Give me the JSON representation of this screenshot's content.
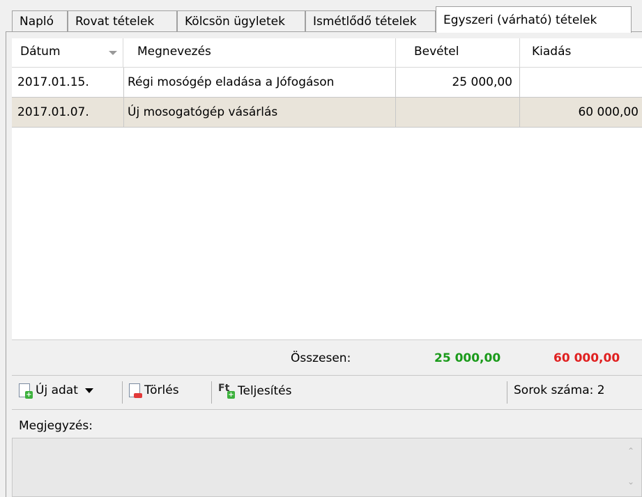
{
  "tabs": [
    {
      "label": "Napló"
    },
    {
      "label": "Rovat tételek"
    },
    {
      "label": "Kölcsön ügyletek"
    },
    {
      "label": "Ismétlődő tételek"
    },
    {
      "label": "Egyszeri (várható) tételek",
      "active": true
    }
  ],
  "grid": {
    "columns": [
      "Dátum",
      "Megnevezés",
      "Bevétel",
      "Kiadás"
    ],
    "rows": [
      {
        "date": "2017.01.15.",
        "name": "Régi mosógép eladása a Jófogáson",
        "income": "25 000,00",
        "expense": ""
      },
      {
        "date": "2017.01.07.",
        "name": "Új mosogatógép vásárlás",
        "income": "",
        "expense": "60 000,00"
      }
    ]
  },
  "totals": {
    "label": "Összesen:",
    "income": "25 000,00",
    "expense": "60 000,00",
    "income_color": "#1a9a1a",
    "expense_color": "#e02020"
  },
  "toolbar": {
    "new_label": "Új adat",
    "delete_label": "Törlés",
    "fulfill_label": "Teljesítés",
    "fulfill_icon_text": "Ft",
    "rowcount_label": "Sorok száma:",
    "rowcount_value": "2"
  },
  "note": {
    "label": "Megjegyzés:",
    "value": ""
  },
  "icons": {
    "new": "document-add-icon",
    "delete": "document-delete-icon",
    "fulfill": "currency-add-icon",
    "sort": "sort-desc-icon"
  }
}
